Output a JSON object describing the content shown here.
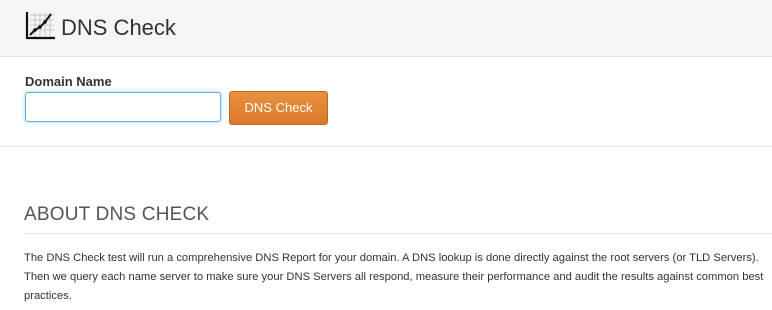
{
  "header": {
    "title": "DNS Check",
    "icon": "chart-grid-icon"
  },
  "form": {
    "label": "Domain Name",
    "input_value": "",
    "input_placeholder": "",
    "button_label": "DNS Check"
  },
  "about": {
    "heading": "ABOUT DNS CHECK",
    "body": "The DNS Check test will run a comprehensive DNS Report for your domain. A DNS lookup is done directly against the root servers (or TLD Servers). Then we query each name server to make sure your DNS Servers all respond, measure their performance and audit the results against common best practices."
  },
  "colors": {
    "header_bg": "#f5f5f5",
    "button_bg": "#e08a35",
    "input_focus": "#66afe9"
  }
}
